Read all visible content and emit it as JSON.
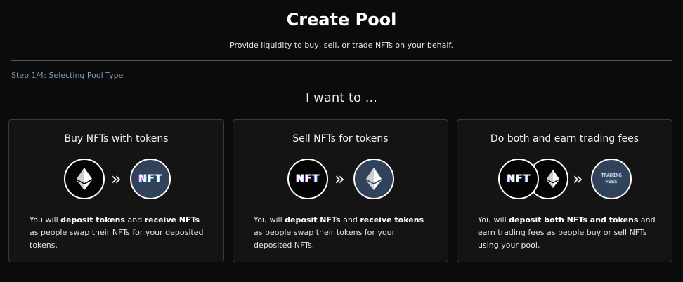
{
  "header": {
    "title": "Create Pool",
    "subtitle": "Provide liquidity to buy, sell, or trade NFTs on your behalf."
  },
  "step": "Step 1/4: Selecting Pool Type",
  "heading": "I want to ...",
  "cards": [
    {
      "title": "Buy NFTs with tokens",
      "icons": [
        "ethereum-icon",
        "chevrons-right-icon",
        "nft-badge-icon"
      ],
      "nft_label": "NFT",
      "desc": {
        "p1": "You will ",
        "b1": "deposit tokens",
        "p2": " and ",
        "b2": "receive NFTs",
        "p3": " as people swap their NFTs for your deposited tokens."
      }
    },
    {
      "title": "Sell NFTs for tokens",
      "icons": [
        "nft-badge-icon",
        "chevrons-right-icon",
        "ethereum-icon"
      ],
      "nft_label": "NFT",
      "desc": {
        "p1": "You will ",
        "b1": "deposit NFTs",
        "p2": " and ",
        "b2": "receive tokens",
        "p3": " as people swap their tokens for your deposited NFTs."
      }
    },
    {
      "title": "Do both and earn trading fees",
      "icons": [
        "nft-badge-icon",
        "ethereum-icon",
        "chevrons-right-icon",
        "trading-fees-icon"
      ],
      "nft_label": "NFT",
      "fees_line1": "TRADING",
      "fees_line2": "FEES",
      "desc": {
        "p1": "You will ",
        "b1": "deposit both NFTs and tokens",
        "p2": " and earn trading fees as people buy or sell NFTs using your pool.",
        "b2": "",
        "p3": ""
      }
    }
  ],
  "colors": {
    "background": "#0b0b0c",
    "card_bg": "#141415",
    "card_border": "#3a3a3a",
    "step_text": "#7f9bb3",
    "eth_circle": "#31435a"
  }
}
